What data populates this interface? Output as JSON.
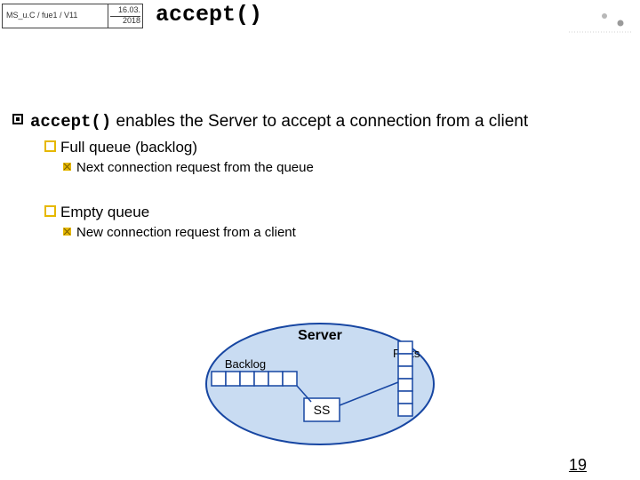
{
  "header": {
    "course": "MS_u.C / fue1 / V11",
    "date_top": "16.03.",
    "date_bottom": "2018"
  },
  "title": "accept()",
  "bullets": {
    "main": {
      "code": "accept()",
      "rest": " enables the Server to accept a connection from a client"
    },
    "sub1": {
      "label": "Full queue (backlog)",
      "item": "Next connection request from the queue"
    },
    "sub2": {
      "label": "Empty queue",
      "item": "New connection request from a client"
    }
  },
  "diagram": {
    "server": "Server",
    "backlog": "Backlog",
    "ports": "Ports",
    "ss": "SS"
  },
  "page_number": "19"
}
